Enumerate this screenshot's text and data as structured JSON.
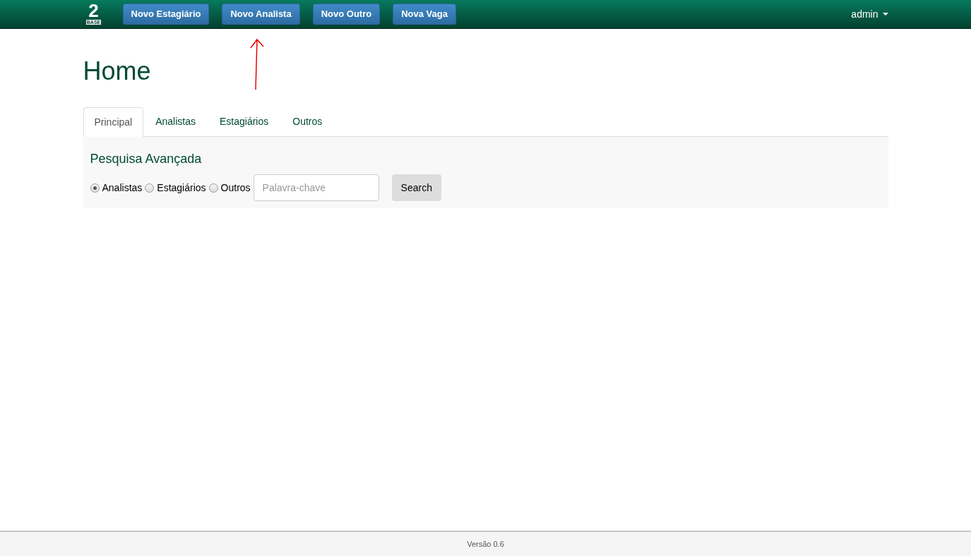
{
  "navbar": {
    "logo": {
      "number": "2",
      "word": "BASE"
    },
    "buttons": [
      "Novo Estagiário",
      "Novo Analista",
      "Novo Outro",
      "Nova Vaga"
    ],
    "user_menu": "admin"
  },
  "page_title": "Home",
  "tabs": [
    {
      "label": "Principal",
      "selected": true
    },
    {
      "label": "Analistas",
      "selected": false
    },
    {
      "label": "Estagiários",
      "selected": false
    },
    {
      "label": "Outros",
      "selected": false
    }
  ],
  "search": {
    "title": "Pesquisa Avançada",
    "options": [
      {
        "label": "Analistas",
        "selected": true
      },
      {
        "label": "Estagiários",
        "selected": false
      },
      {
        "label": "Outros",
        "selected": false
      }
    ],
    "placeholder": "Palavra-chave",
    "button": "Search"
  },
  "footer": "Versão 0.6"
}
